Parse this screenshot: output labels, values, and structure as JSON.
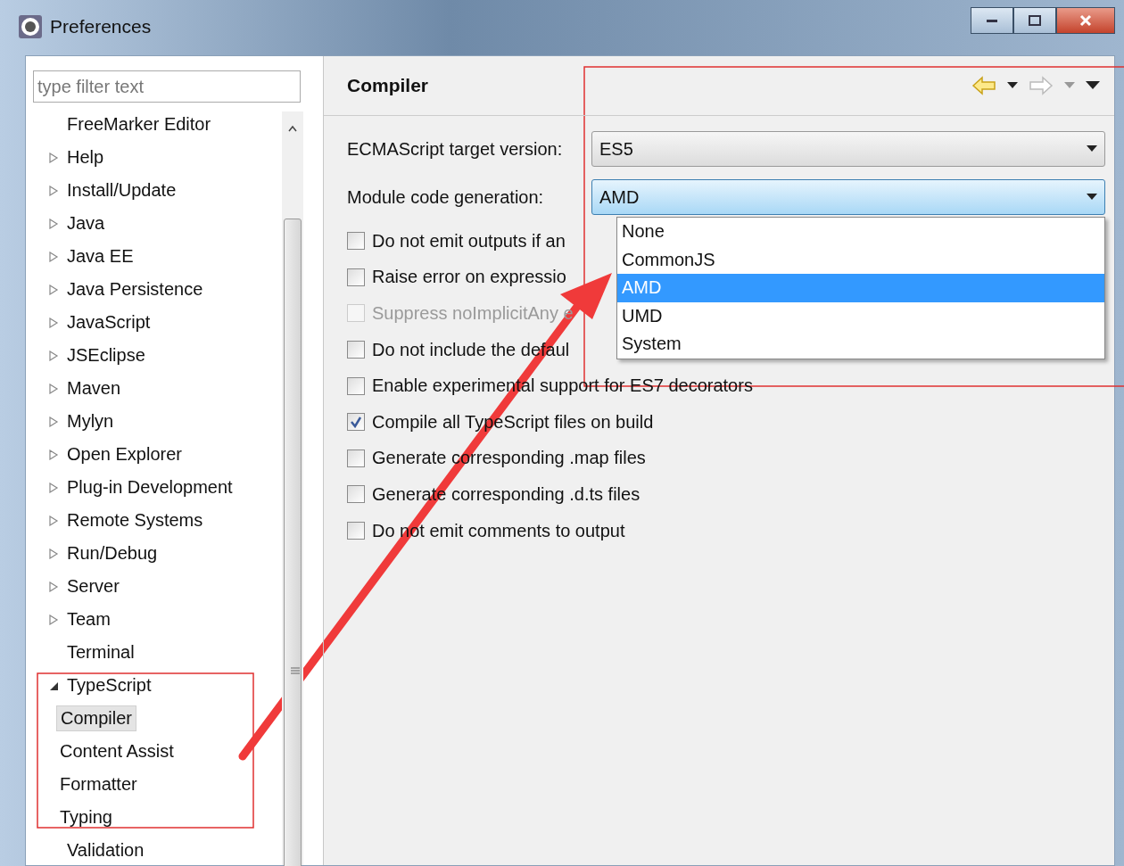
{
  "window": {
    "title": "Preferences"
  },
  "filter": {
    "placeholder": "type filter text"
  },
  "tree": {
    "items": [
      {
        "kind": "leaf",
        "label": "FreeMarker Editor",
        "selected": false
      },
      {
        "kind": "group",
        "label": "Help",
        "expanded": false,
        "selected": false
      },
      {
        "kind": "group",
        "label": "Install/Update",
        "expanded": false,
        "selected": false
      },
      {
        "kind": "group",
        "label": "Java",
        "expanded": false,
        "selected": false
      },
      {
        "kind": "group",
        "label": "Java EE",
        "expanded": false,
        "selected": false
      },
      {
        "kind": "group",
        "label": "Java Persistence",
        "expanded": false,
        "selected": false
      },
      {
        "kind": "group",
        "label": "JavaScript",
        "expanded": false,
        "selected": false
      },
      {
        "kind": "group",
        "label": "JSEclipse",
        "expanded": false,
        "selected": false
      },
      {
        "kind": "group",
        "label": "Maven",
        "expanded": false,
        "selected": false
      },
      {
        "kind": "group",
        "label": "Mylyn",
        "expanded": false,
        "selected": false
      },
      {
        "kind": "group",
        "label": "Open Explorer",
        "expanded": false,
        "selected": false
      },
      {
        "kind": "group",
        "label": "Plug-in Development",
        "expanded": false,
        "selected": false
      },
      {
        "kind": "group",
        "label": "Remote Systems",
        "expanded": false,
        "selected": false
      },
      {
        "kind": "group",
        "label": "Run/Debug",
        "expanded": false,
        "selected": false
      },
      {
        "kind": "group",
        "label": "Server",
        "expanded": false,
        "selected": false
      },
      {
        "kind": "group",
        "label": "Team",
        "expanded": false,
        "selected": false
      },
      {
        "kind": "leaf",
        "label": "Terminal",
        "selected": false
      },
      {
        "kind": "group",
        "label": "TypeScript",
        "expanded": true,
        "selected": false,
        "children": [
          {
            "label": "Compiler",
            "selected": true
          },
          {
            "label": "Content Assist",
            "selected": false
          },
          {
            "label": "Formatter",
            "selected": false
          },
          {
            "label": "Typing",
            "selected": false
          }
        ]
      },
      {
        "kind": "leaf",
        "label": "Validation",
        "selected": false
      }
    ]
  },
  "page": {
    "title": "Compiler",
    "settings": [
      {
        "label": "ECMAScript target version:",
        "value": "ES5",
        "focused": false
      },
      {
        "label": "Module code generation:",
        "value": "AMD",
        "focused": true
      }
    ],
    "dropdown_options": [
      {
        "label": "None",
        "selected": false
      },
      {
        "label": "CommonJS",
        "selected": false
      },
      {
        "label": "AMD",
        "selected": true
      },
      {
        "label": "UMD",
        "selected": false
      },
      {
        "label": "System",
        "selected": false
      }
    ],
    "checkboxes": [
      {
        "label": "Do not emit outputs if an",
        "checked": false,
        "disabled": false
      },
      {
        "label": "Raise error on expressio",
        "checked": false,
        "disabled": false
      },
      {
        "label": "Suppress noImplicitAny e",
        "checked": false,
        "disabled": true
      },
      {
        "label": "Do not include the defaul",
        "checked": false,
        "disabled": false
      },
      {
        "label": "Enable experimental support for ES7 decorators",
        "checked": false,
        "disabled": false
      },
      {
        "label": "Compile all TypeScript files on build",
        "checked": true,
        "disabled": false
      },
      {
        "label": "Generate corresponding .map files",
        "checked": false,
        "disabled": false
      },
      {
        "label": "Generate corresponding .d.ts files",
        "checked": false,
        "disabled": false
      },
      {
        "label": "Do not emit comments to output",
        "checked": false,
        "disabled": false
      }
    ]
  }
}
